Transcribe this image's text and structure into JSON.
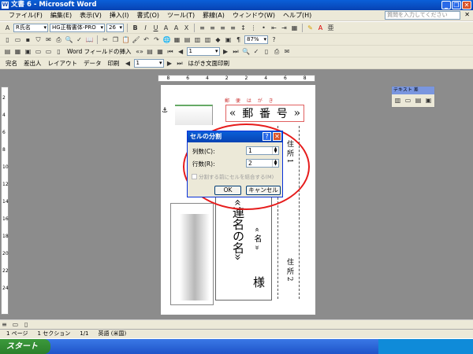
{
  "window": {
    "title": "文書 6 - Microsoft Word"
  },
  "menu": [
    "ファイル(F)",
    "編集(E)",
    "表示(V)",
    "挿入(I)",
    "書式(O)",
    "ツール(T)",
    "罫線(A)",
    "ウィンドウ(W)",
    "ヘルプ(H)"
  ],
  "help_box": {
    "placeholder": "質問を入力してください"
  },
  "toolbar": {
    "style": "R氏名",
    "font": "HG正楷書体-PRO",
    "size": "26",
    "zoom": "87%",
    "word_field_insert": "Word フィールドの挿入",
    "page_field": "1"
  },
  "mailmerge_bar": {
    "items": [
      "完名",
      "差出人",
      "レイアウト",
      "データ",
      "印刷"
    ],
    "record": "1",
    "postcard_print": "はがき文面印刷"
  },
  "ruler": {
    "h_ticks": [
      "8",
      "6",
      "4",
      "2",
      "2",
      "4",
      "6",
      "8"
    ],
    "v_ticks": [
      "2",
      "4",
      "6",
      "8",
      "10",
      "12",
      "14",
      "16",
      "18",
      "20",
      "22",
      "24"
    ]
  },
  "postcard": {
    "postal_header": "郵 便 は が き",
    "postal_field": [
      "«",
      "郵",
      "番",
      "号",
      "»"
    ],
    "address1": "住 所 1",
    "address2": "住 所 2",
    "name_left": "«連名の名»",
    "name_right": "« 名 »",
    "honorific": "様"
  },
  "dialog": {
    "title": "セルの分割",
    "columns_label": "列数(C):",
    "columns_value": "1",
    "rows_label": "行数(R):",
    "rows_value": "2",
    "merge_label": "分割する前にセルを結合する(M)",
    "ok": "OK",
    "cancel": "キャンセル"
  },
  "floating_toolbar": {
    "title": "テキスト 差"
  },
  "status": {
    "page": "1 ページ",
    "section": "1 セクション",
    "pages": "1/1",
    "lang": "英語 (米国)"
  },
  "taskbar": {
    "start": "スタート"
  }
}
